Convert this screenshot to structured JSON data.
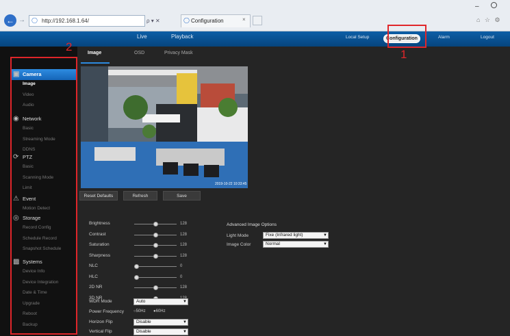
{
  "browser": {
    "address": "http://192.168.1.64/",
    "tab_title": "Configuration",
    "address_tools": "ρ ▾ ✕",
    "tab_close": "×",
    "window_min": "–",
    "window_tools": "⌂ ☆ ⚙"
  },
  "topnav": {
    "live": "Live",
    "playback": "Playback",
    "local_setup": "Local Setup",
    "configuration": "Configuration",
    "alarm": "Alarm",
    "logout": "Logout"
  },
  "annotations": {
    "one": "1",
    "two": "2"
  },
  "sidebar": {
    "sections": [
      {
        "label": "Camera",
        "icon": "camera-icon",
        "items": [
          "Image",
          "Video",
          "Audio"
        ]
      },
      {
        "label": "Network",
        "icon": "network-icon",
        "items": [
          "Basic",
          "Streaming Mode",
          "DDNS"
        ]
      },
      {
        "label": "PTZ",
        "icon": "ptz-icon",
        "items": [
          "Basic",
          "Scanning Mode",
          "Limit"
        ]
      },
      {
        "label": "Event",
        "icon": "event-icon",
        "items": [
          "Motion Detect"
        ]
      },
      {
        "label": "Storage",
        "icon": "storage-icon",
        "items": [
          "Record Config",
          "Schedule Record",
          "Snapshot Schedule"
        ]
      },
      {
        "label": "Systems",
        "icon": "systems-icon",
        "items": [
          "Device Info",
          "Device Integration",
          "Date & Time",
          "Upgrade",
          "Reboot",
          "Backup"
        ]
      }
    ]
  },
  "subtabs": [
    "Image",
    "OSD",
    "Privacy Mask"
  ],
  "buttons": {
    "reset": "Reset Defaults",
    "refresh": "Refresh",
    "save": "Save"
  },
  "osd_text": "2019-10-22 10:33:45",
  "image_settings": [
    {
      "label": "Brightness",
      "value": "128",
      "pos": 0.5
    },
    {
      "label": "Contrast",
      "value": "128",
      "pos": 0.5
    },
    {
      "label": "Saturation",
      "value": "128",
      "pos": 0.5
    },
    {
      "label": "Sharpness",
      "value": "128",
      "pos": 0.5
    },
    {
      "label": "NLC",
      "value": "0",
      "pos": 0
    },
    {
      "label": "HLC",
      "value": "0",
      "pos": 0
    },
    {
      "label": "2D NR",
      "value": "128",
      "pos": 0.5
    },
    {
      "label": "3D NR",
      "value": "128",
      "pos": 0.5
    }
  ],
  "dropdowns": [
    {
      "label": "WDR Mode",
      "value": "Auto"
    },
    {
      "label": "Power Frequency",
      "value": ""
    },
    {
      "label": "Horizon Flip",
      "value": "Disable"
    },
    {
      "label": "Vertical Flip",
      "value": "Disable"
    }
  ],
  "power_frequency": {
    "opt1": "50Hz",
    "opt2": "60Hz"
  },
  "advanced": {
    "title": "Advanced Image Options",
    "light_mode_label": "Light Mode",
    "light_mode_value": "Fixe (Infrared light)",
    "image_color_label": "Image Color",
    "image_color_value": "Normal"
  },
  "colors": {
    "accent": "#2d8be0",
    "appbar": "#0d5ea6",
    "annotation": "#e0262a"
  }
}
